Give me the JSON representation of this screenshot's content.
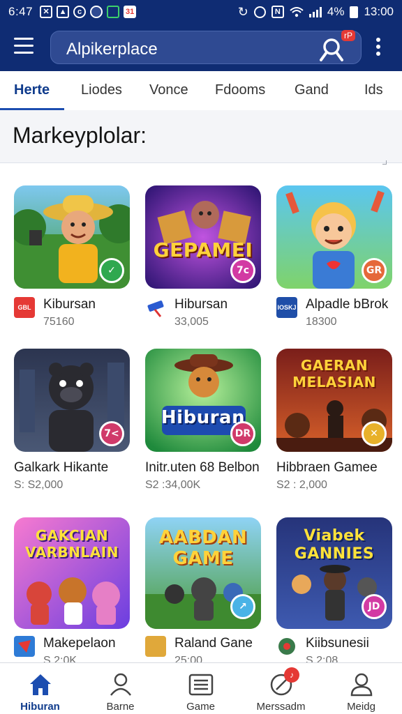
{
  "status_bar": {
    "time_left": "6:47",
    "time_right": "13:00",
    "battery": "4%",
    "icons_left": [
      "gallery-x-icon",
      "image-icon",
      "circle-c-icon",
      "dark-circle-icon",
      "battery-saver-icon",
      "calendar-icon"
    ],
    "icons_right": [
      "sync-icon",
      "alarm-icon",
      "nfc-icon",
      "wifi-icon",
      "signal-icon",
      "battery-icon"
    ]
  },
  "header": {
    "search_text": "Alpikerplace",
    "search_badge": "rP",
    "accent": "#0f2c73"
  },
  "tabs": [
    {
      "label": "Herte",
      "active": true
    },
    {
      "label": "Liodes"
    },
    {
      "label": "Vonce"
    },
    {
      "label": "Fdooms"
    },
    {
      "label": "Gand"
    },
    {
      "label": "Ids"
    }
  ],
  "section": {
    "title": "Markeyplolar:"
  },
  "apps": [
    {
      "name": "Kibursan",
      "sub": "75160",
      "dev_icon": "GBL XMKO",
      "badge": "✓",
      "art_title": ""
    },
    {
      "name": "Hibursan",
      "sub": "33,005",
      "dev_icon": "",
      "badge": "7c",
      "art_title": "GEPAMEI"
    },
    {
      "name": "Alpadle bBrok",
      "sub": "18300",
      "dev_icon": "IOSKJ dlm",
      "badge": "GR",
      "art_title": ""
    },
    {
      "name": "Galkark Hikante",
      "sub": "S: S2,000",
      "dev_icon": "",
      "badge": "7<",
      "art_title": ""
    },
    {
      "name": "Initr.uten 68 Belbon",
      "sub": "S2 :34,00K",
      "dev_icon": "",
      "badge": "DR",
      "art_title": "Hiburan"
    },
    {
      "name": "Hibbraen Gamee",
      "sub": "S2 : 2,000",
      "dev_icon": "",
      "badge": "✕",
      "art_title": "GAERAN MELASIAN"
    },
    {
      "name": "Makepelaon",
      "sub": "S 2:0K",
      "dev_icon": "",
      "badge": "",
      "art_title": "GAKCIAN VARBNLAIN"
    },
    {
      "name": "Raland Gane",
      "sub": "25:00",
      "dev_icon": "",
      "badge": "↗",
      "art_title": "AABDAN GAME"
    },
    {
      "name": "Kiibsunesii",
      "sub": "S 2:08",
      "dev_icon": "",
      "badge": "JD",
      "art_title": "Viabek GANNIES"
    }
  ],
  "bottom_nav": [
    {
      "label": "Hiburan",
      "icon": "home-icon",
      "active": true
    },
    {
      "label": "Barne",
      "icon": "person-icon"
    },
    {
      "label": "Game",
      "icon": "list-icon"
    },
    {
      "label": "Merssadm",
      "icon": "message-icon",
      "badge": "♪"
    },
    {
      "label": "Meidg",
      "icon": "profile-icon"
    }
  ]
}
